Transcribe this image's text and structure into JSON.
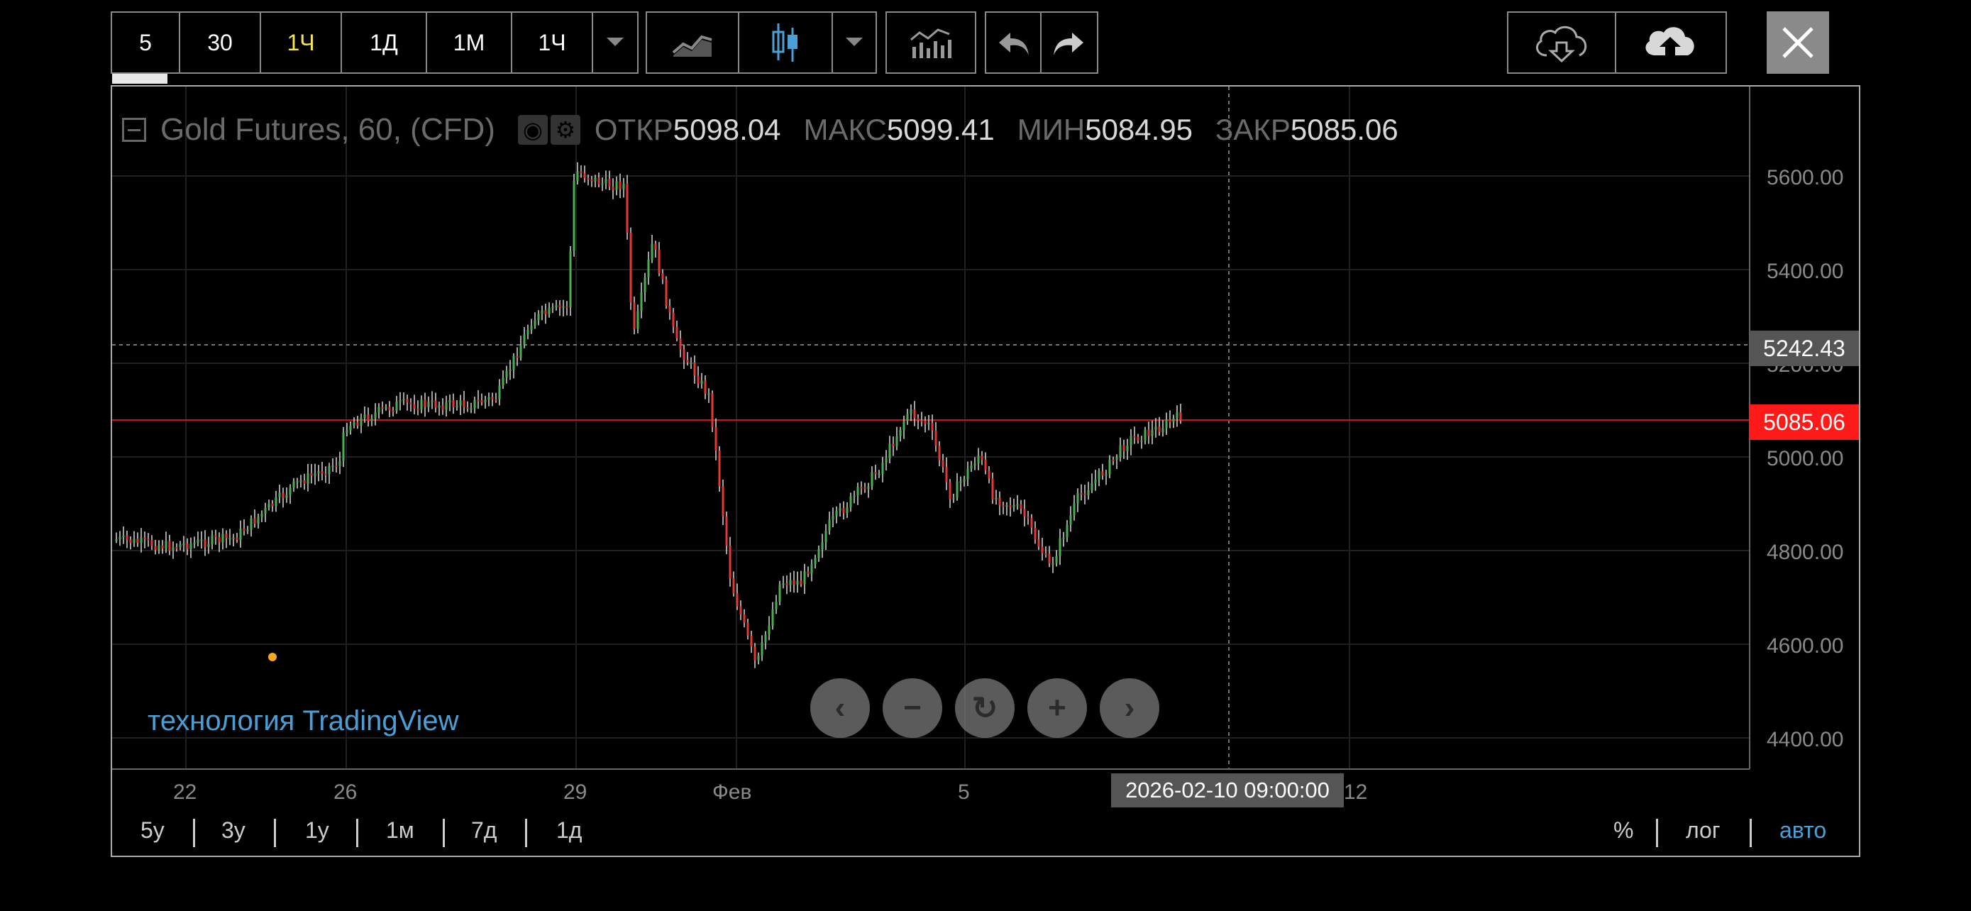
{
  "toolbar": {
    "intervals": [
      "5",
      "30",
      "1Ч",
      "1Д",
      "1М",
      "1Ч"
    ],
    "active_interval_index": 2
  },
  "legend": {
    "title": "Gold Futures, 60, (CFD)",
    "open_label": "ОТКР",
    "open_value": "5098.04",
    "high_label": "МАКС",
    "high_value": "5099.41",
    "low_label": "МИН",
    "low_value": "5084.95",
    "close_label": "ЗАКР",
    "close_value": "5085.06"
  },
  "price_axis": [
    "5600.00",
    "5400.00",
    "5200.00",
    "5000.00",
    "4800.00",
    "4600.00",
    "4400.00"
  ],
  "crosshair_price": "5242.43",
  "last_price": "5085.06",
  "time_axis": [
    "22",
    "26",
    "29",
    "Фев",
    "5",
    "12"
  ],
  "crosshair_time": "2026-02-10 09:00:00",
  "ranges": [
    "5y",
    "3y",
    "1y",
    "1м",
    "7д",
    "1д"
  ],
  "scale_options": [
    "%",
    "лог",
    "авто"
  ],
  "brand": "технология TradingView",
  "colors": {
    "up": "#4caf50",
    "down": "#e53935",
    "last_price": "#ff1a1a",
    "active": "#f2e84a",
    "brand": "#4a9fd5"
  }
}
